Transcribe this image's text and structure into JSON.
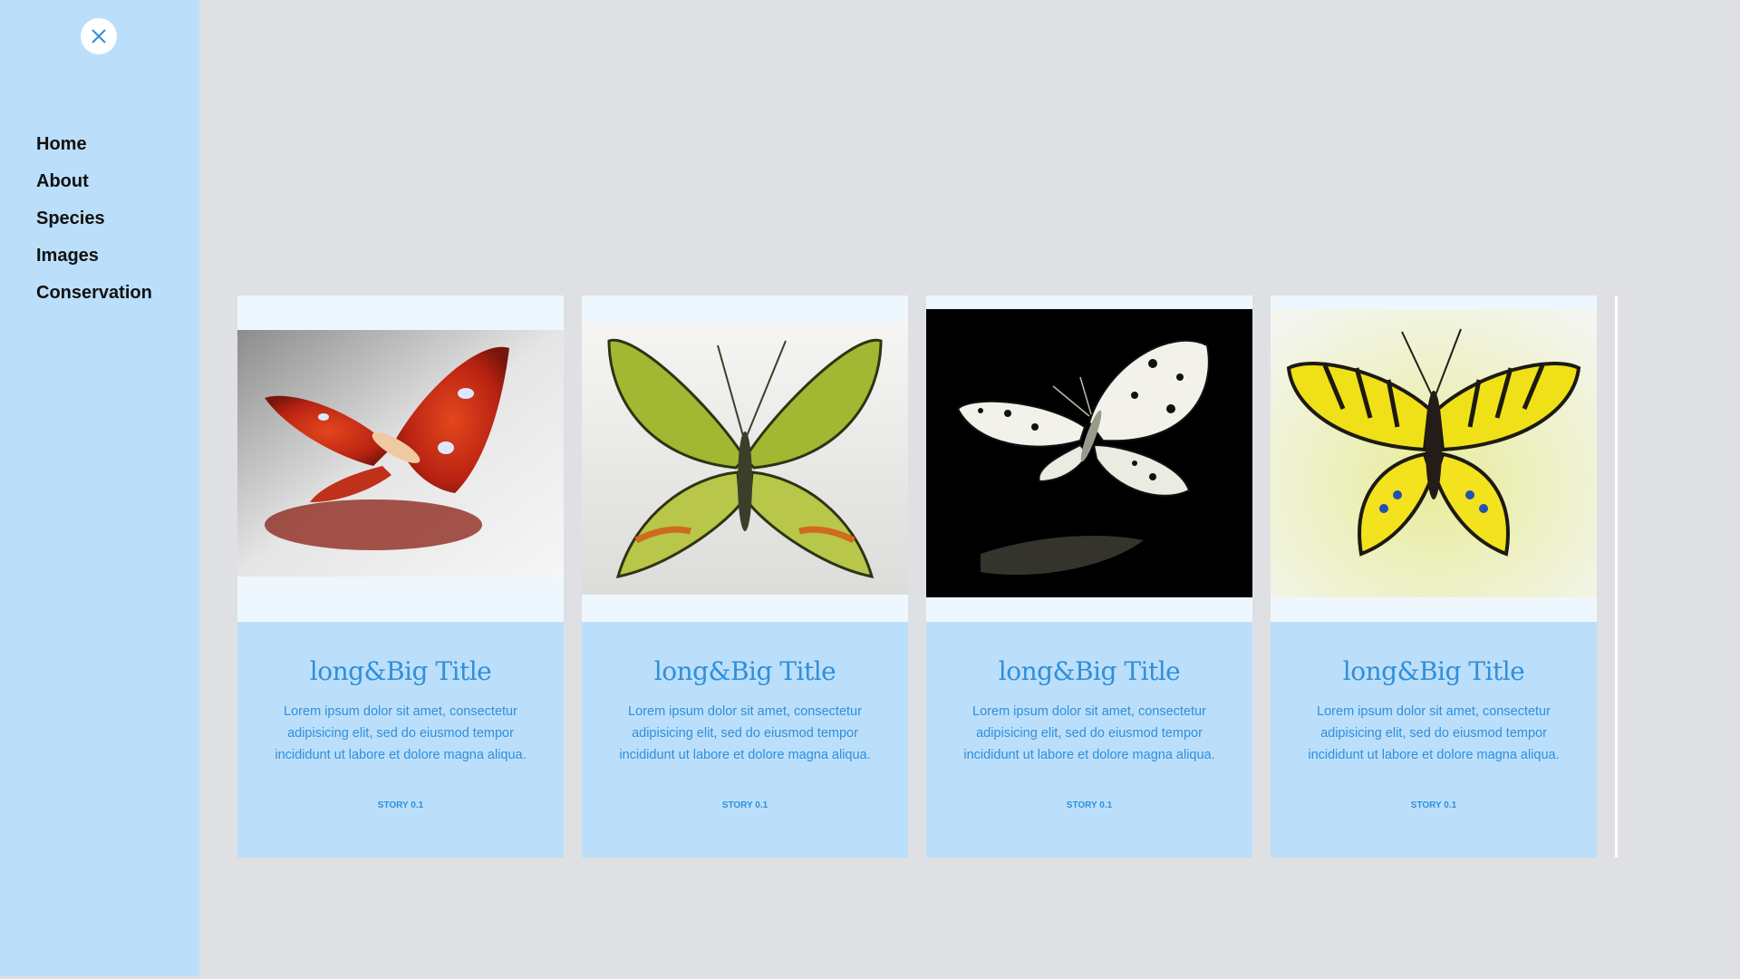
{
  "sidebar": {
    "close_icon": "close-icon",
    "nav": [
      "Home",
      "About",
      "Species",
      "Images",
      "Conservation"
    ]
  },
  "cards": [
    {
      "title": "long&Big Title",
      "text": "Lorem ipsum dolor sit amet, consectetur adipisicing elit, sed do eiusmod tempor incididunt ut labore et dolore magna aliqua.",
      "link": "STORY 0.1",
      "image": "red atlas moth on white background"
    },
    {
      "title": "long&Big Title",
      "text": "Lorem ipsum dolor sit amet, consectetur adipisicing elit, sed do eiusmod tempor incididunt ut labore et dolore magna aliqua.",
      "link": "STORY 0.1",
      "image": "green swallowtail butterfly on white background"
    },
    {
      "title": "long&Big Title",
      "text": "Lorem ipsum dolor sit amet, consectetur adipisicing elit, sed do eiusmod tempor incididunt ut labore et dolore magna aliqua.",
      "link": "STORY 0.1",
      "image": "black and white tree nymph butterfly on black background"
    },
    {
      "title": "long&Big Title",
      "text": "Lorem ipsum dolor sit amet, consectetur adipisicing elit, sed do eiusmod tempor incididunt ut labore et dolore magna aliqua.",
      "link": "STORY 0.1",
      "image": "yellow tiger swallowtail butterfly on white background"
    }
  ],
  "colors": {
    "sidebar_bg": "#bbdffa",
    "page_bg": "#dfe0e3",
    "accent": "#2f8fdc",
    "card_media_bg": "#eff7fe"
  }
}
